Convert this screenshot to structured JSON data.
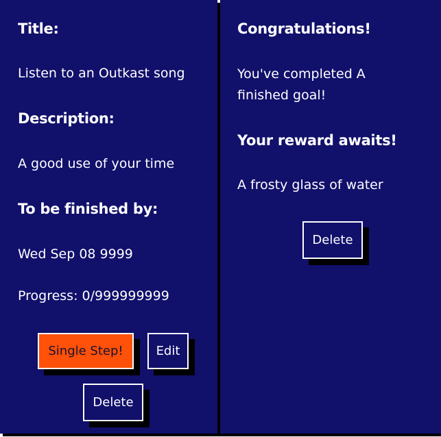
{
  "goal_card": {
    "title_heading": "Title:",
    "title_value": "Listen to an Outkast song",
    "description_heading": "Description:",
    "description_value": "A good use of your time",
    "deadline_heading": "To be finished by:",
    "deadline_value": "Wed Sep 08 9999",
    "progress_text": "Progress: 0/999999999",
    "progress_current": 0,
    "progress_target": 999999999,
    "buttons": {
      "single_step": "Single Step!",
      "edit": "Edit",
      "delete": "Delete"
    }
  },
  "completed_card": {
    "congrats_heading": "Congratulations!",
    "completed_text": "You've completed A finished goal!",
    "reward_heading": "Your reward awaits!",
    "reward_value": "A frosty glass of water",
    "buttons": {
      "delete": "Delete"
    }
  },
  "colors": {
    "card_background": "#11106b",
    "accent_button": "#ff5109",
    "text": "#ffffff",
    "shadow": "#000000"
  }
}
